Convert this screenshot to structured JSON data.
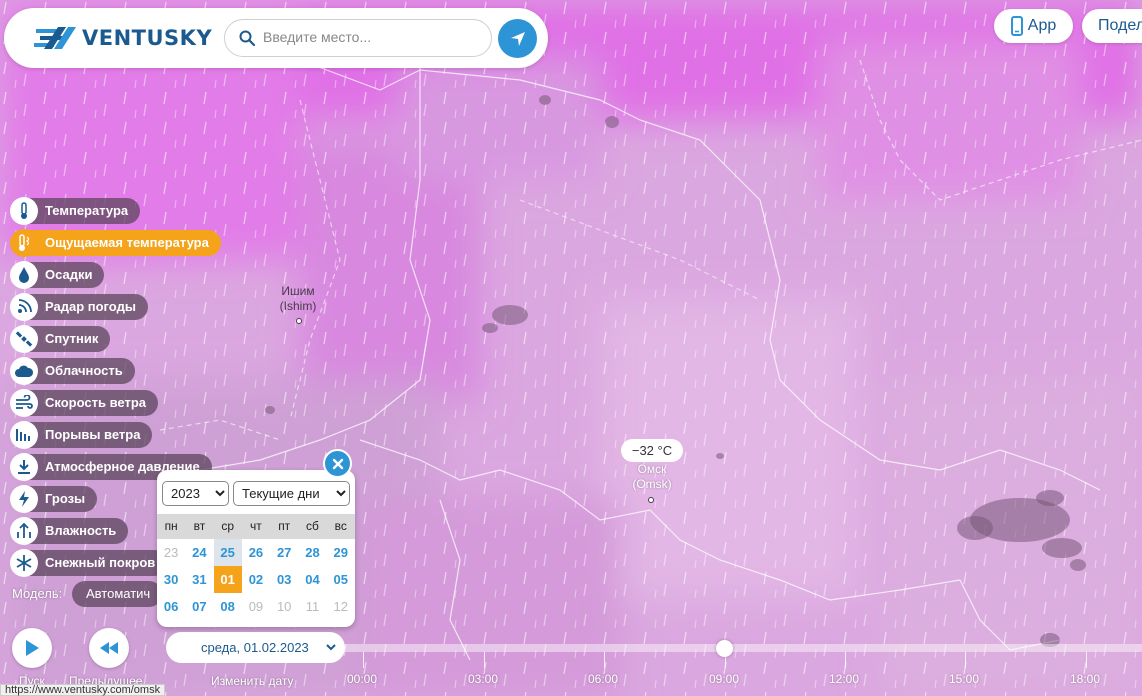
{
  "header": {
    "brand": "VENTUSKY",
    "search_placeholder": "Введите место...",
    "app_label": "App",
    "share_label": "Подел"
  },
  "layers": [
    {
      "label": "Температура",
      "icon": "thermometer-icon",
      "active": false
    },
    {
      "label": "Ощущаемая температура",
      "icon": "feels-like-icon",
      "active": true
    },
    {
      "label": "Осадки",
      "icon": "drop-icon",
      "active": false
    },
    {
      "label": "Радар погоды",
      "icon": "radar-icon",
      "active": false
    },
    {
      "label": "Спутник",
      "icon": "satellite-icon",
      "active": false
    },
    {
      "label": "Облачность",
      "icon": "cloud-icon",
      "active": false
    },
    {
      "label": "Скорость ветра",
      "icon": "wind-icon",
      "active": false
    },
    {
      "label": "Порывы ветра",
      "icon": "gust-icon",
      "active": false
    },
    {
      "label": "Атмосферное давление",
      "icon": "pressure-icon",
      "active": false
    },
    {
      "label": "Грозы",
      "icon": "lightning-icon",
      "active": false
    },
    {
      "label": "Влажность",
      "icon": "humidity-icon",
      "active": false
    },
    {
      "label": "Снежный покров",
      "icon": "snowflake-icon",
      "active": false
    }
  ],
  "model": {
    "label": "Модель:",
    "value": "Автоматич"
  },
  "map": {
    "cities": [
      {
        "name": "Ишим",
        "latin": "(Ishim)"
      },
      {
        "name": "Омск",
        "latin": "(Omsk)",
        "temperature": "−32 °C"
      }
    ]
  },
  "calendar": {
    "year": "2023",
    "mode": "Текущие дни",
    "weekdays": [
      "пн",
      "вт",
      "ср",
      "чт",
      "пт",
      "сб",
      "вс"
    ],
    "weeks": [
      [
        {
          "d": "23",
          "s": "dim"
        },
        {
          "d": "24",
          "s": ""
        },
        {
          "d": "25",
          "s": "sel"
        },
        {
          "d": "26",
          "s": ""
        },
        {
          "d": "27",
          "s": ""
        },
        {
          "d": "28",
          "s": ""
        },
        {
          "d": "29",
          "s": ""
        }
      ],
      [
        {
          "d": "30",
          "s": ""
        },
        {
          "d": "31",
          "s": ""
        },
        {
          "d": "01",
          "s": "today"
        },
        {
          "d": "02",
          "s": ""
        },
        {
          "d": "03",
          "s": ""
        },
        {
          "d": "04",
          "s": ""
        },
        {
          "d": "05",
          "s": ""
        }
      ],
      [
        {
          "d": "06",
          "s": ""
        },
        {
          "d": "07",
          "s": ""
        },
        {
          "d": "08",
          "s": ""
        },
        {
          "d": "09",
          "s": "dim"
        },
        {
          "d": "10",
          "s": "dim"
        },
        {
          "d": "11",
          "s": "dim"
        },
        {
          "d": "12",
          "s": "dim"
        }
      ]
    ]
  },
  "controls": {
    "play_label": "Пуск",
    "prev_label": "Предыдущее",
    "date": "среда, 01.02.2023",
    "change_date_label": "Изменить дату"
  },
  "timeline": {
    "hours": [
      "00:00",
      "03:00",
      "06:00",
      "09:00",
      "12:00",
      "15:00",
      "18:00"
    ],
    "current": "09:00"
  },
  "status_url": "https://www.ventusky.com/omsk",
  "colors": {
    "accent": "#2d95d5",
    "active": "#f4a31a",
    "brand": "#1b5a8f"
  }
}
